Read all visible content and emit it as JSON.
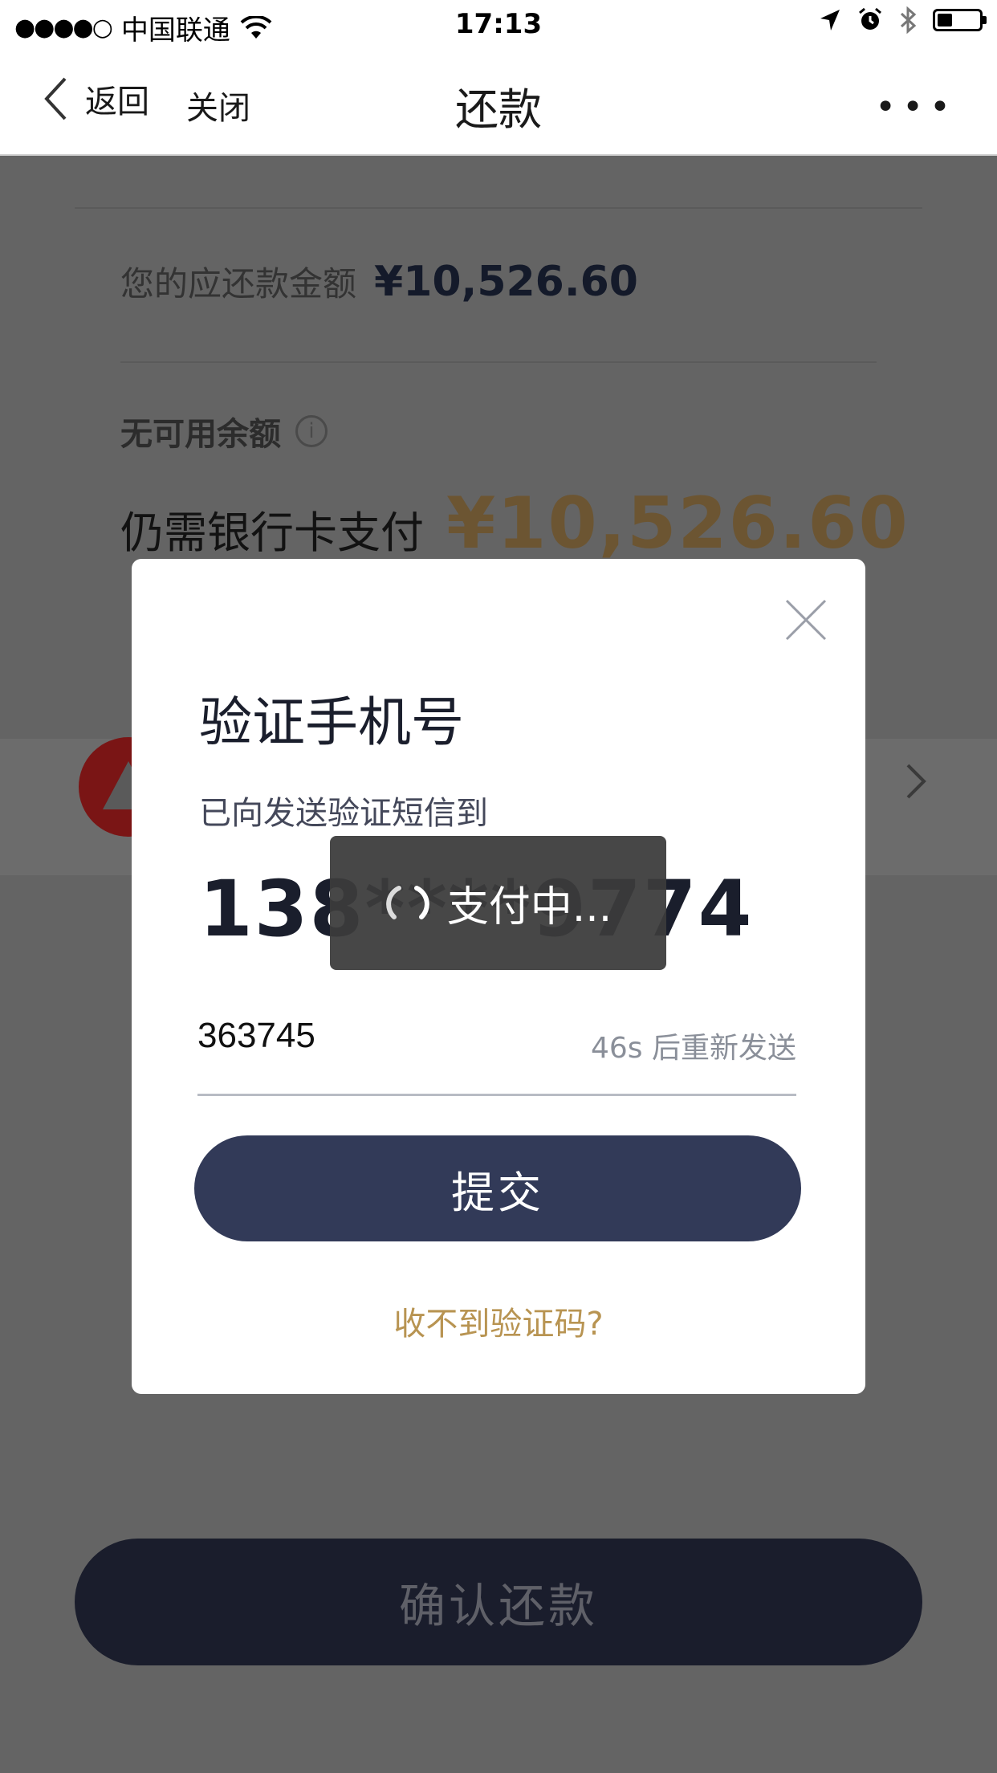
{
  "status_bar": {
    "signal": "●●●●○",
    "carrier": "中国联通",
    "time": "17:13",
    "battery_level": 0.3
  },
  "nav": {
    "back_label": "返回",
    "close_label": "关闭",
    "title": "还款",
    "more_label": "•••"
  },
  "page": {
    "due_label": "您的应还款金额",
    "due_amount": "¥10,526.60",
    "balance_label": "无可用余额",
    "info_icon_glyph": "i",
    "card_pay_label": "仍需银行卡支付",
    "card_pay_amount": "¥10,526.60",
    "confirm_button": "确认还款"
  },
  "modal": {
    "title": "验证手机号",
    "subtitle": "已向发送验证短信到",
    "phone": "138****9774",
    "code_value": "363745",
    "resend_text": "46s 后重新发送",
    "submit_button": "提交",
    "no_code_link": "收不到验证码?"
  },
  "toast": {
    "text": "支付中..."
  },
  "colors": {
    "overlay": "#646464",
    "primary_button": "#323a58",
    "confirm_button": "#1a1d2c",
    "gold_amount": "#6c5532",
    "link_gold": "#b89452"
  },
  "icons": [
    "back-chevron-icon",
    "wifi-icon",
    "location-arrow-icon",
    "alarm-icon",
    "bluetooth-icon",
    "battery-icon",
    "info-icon",
    "bank-logo-icon",
    "chevron-right-icon",
    "close-icon",
    "spinner-icon"
  ]
}
